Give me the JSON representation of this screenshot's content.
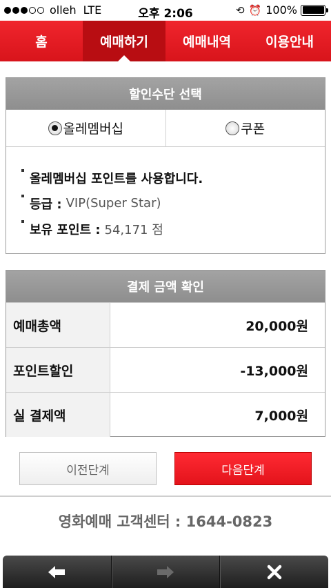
{
  "status_bar": {
    "carrier": "olleh",
    "network": "LTE",
    "time": "오후 2:06",
    "battery": "100%"
  },
  "nav": {
    "tabs": [
      {
        "label": "홈"
      },
      {
        "label": "예매하기",
        "active": true
      },
      {
        "label": "예매내역"
      },
      {
        "label": "이용안내"
      }
    ]
  },
  "discount": {
    "title": "할인수단 선택",
    "options": [
      {
        "label": "올레멤버십",
        "selected": true
      },
      {
        "label": "쿠폰",
        "selected": false
      }
    ],
    "info": {
      "line1": "올레멤버십 포인트를 사용합니다.",
      "grade_label": "등급 :",
      "grade_value": "VIP(Super Star)",
      "points_label": "보유 포인트 :",
      "points_value": "54,171 점"
    }
  },
  "payment": {
    "title": "결제 금액 확인",
    "rows": [
      {
        "label": "예매총액",
        "value": "20,000원"
      },
      {
        "label": "포인트할인",
        "value": "-13,000원"
      },
      {
        "label": "실 결제액",
        "value": "7,000원"
      }
    ]
  },
  "buttons": {
    "prev": "이전단계",
    "next": "다음단계"
  },
  "customer_center": "영화예매 고객센터 : 1644-0823",
  "toolbar": {
    "back_icon": "left-arrow-icon",
    "forward_icon": "right-arrow-icon",
    "close_icon": "close-icon"
  },
  "colors": {
    "brand_red": "#e3131b",
    "active_tab": "#b80d12",
    "panel_header": "#999999"
  }
}
